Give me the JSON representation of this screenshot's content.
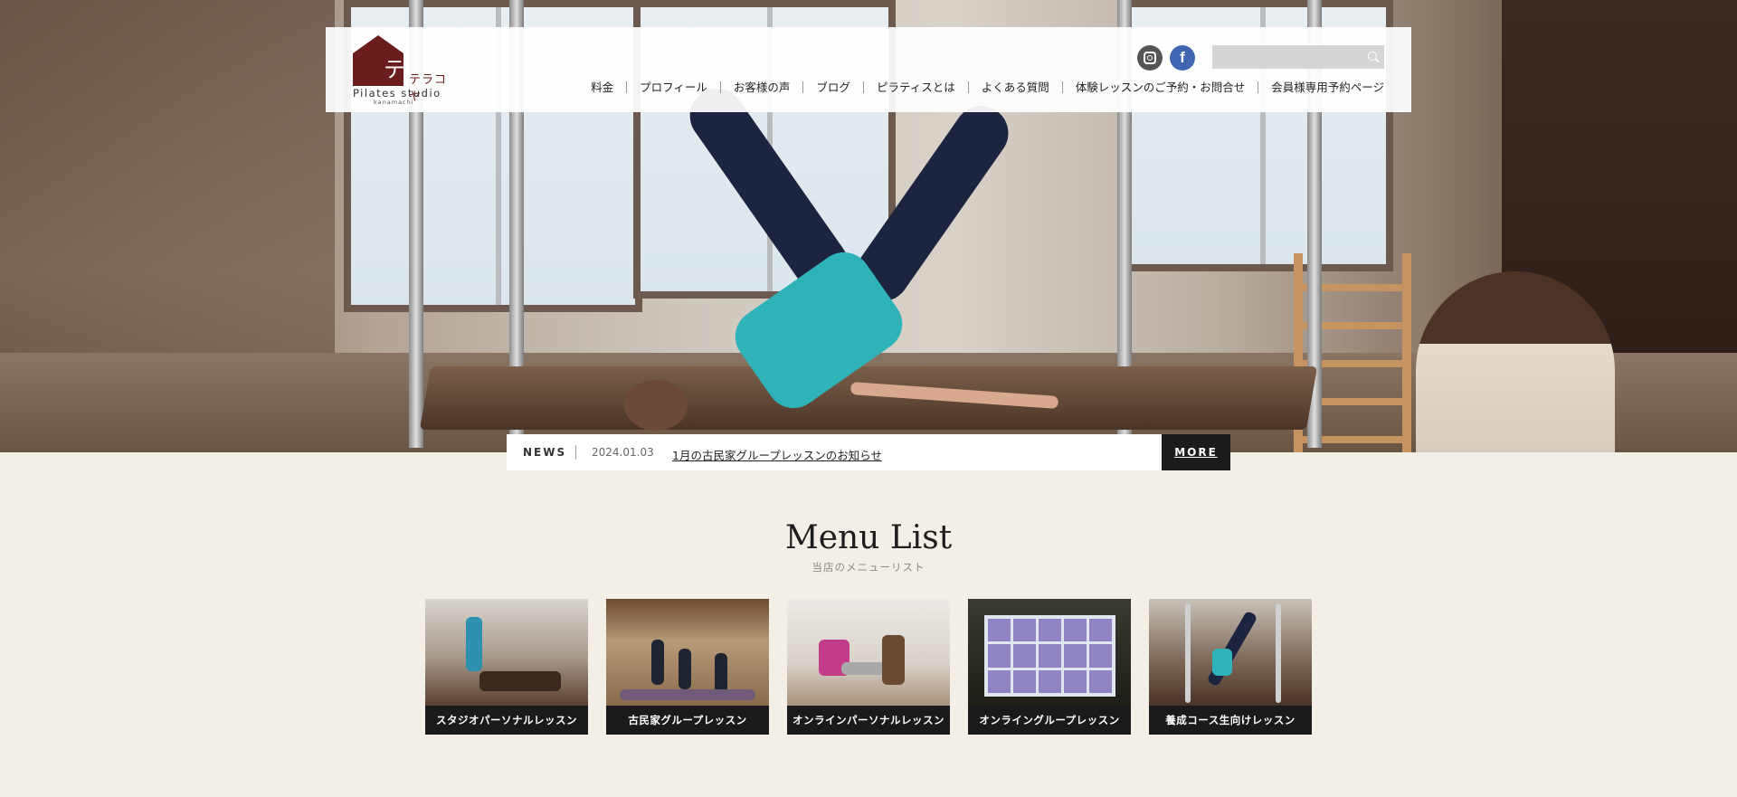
{
  "header": {
    "logo": {
      "kana": "テラコヤ",
      "text_en": "Pilates studio",
      "subtext": "kanamachi",
      "color": "#6b1c1c"
    },
    "social": {
      "instagram_icon": "instagram-icon",
      "facebook_icon": "facebook-icon",
      "facebook_glyph": "f"
    },
    "search": {
      "placeholder": "",
      "icon": "search-icon"
    },
    "nav": [
      {
        "label": "料金"
      },
      {
        "label": "プロフィール"
      },
      {
        "label": "お客様の声"
      },
      {
        "label": "ブログ"
      },
      {
        "label": "ピラティスとは"
      },
      {
        "label": "よくある質問"
      },
      {
        "label": "体験レッスンのご予約・お問合せ"
      },
      {
        "label": "会員様専用予約ページ"
      }
    ]
  },
  "news": {
    "label": "NEWS",
    "date": "2024.01.03",
    "title": "1月の古民家グループレッスンのお知らせ",
    "more_label": "MORE"
  },
  "menu": {
    "title": "Menu List",
    "subtitle": "当店のメニューリスト",
    "items": [
      {
        "label": "スタジオパーソナルレッスン"
      },
      {
        "label": "古民家グループレッスン"
      },
      {
        "label": "オンラインパーソナルレッスン"
      },
      {
        "label": "オンライングループレッスン"
      },
      {
        "label": "養成コース生向けレッスン"
      }
    ]
  },
  "colors": {
    "background": "#f3efe6",
    "brand": "#6b1c1c",
    "dark": "#1b1b1b",
    "facebook": "#4267b2"
  }
}
